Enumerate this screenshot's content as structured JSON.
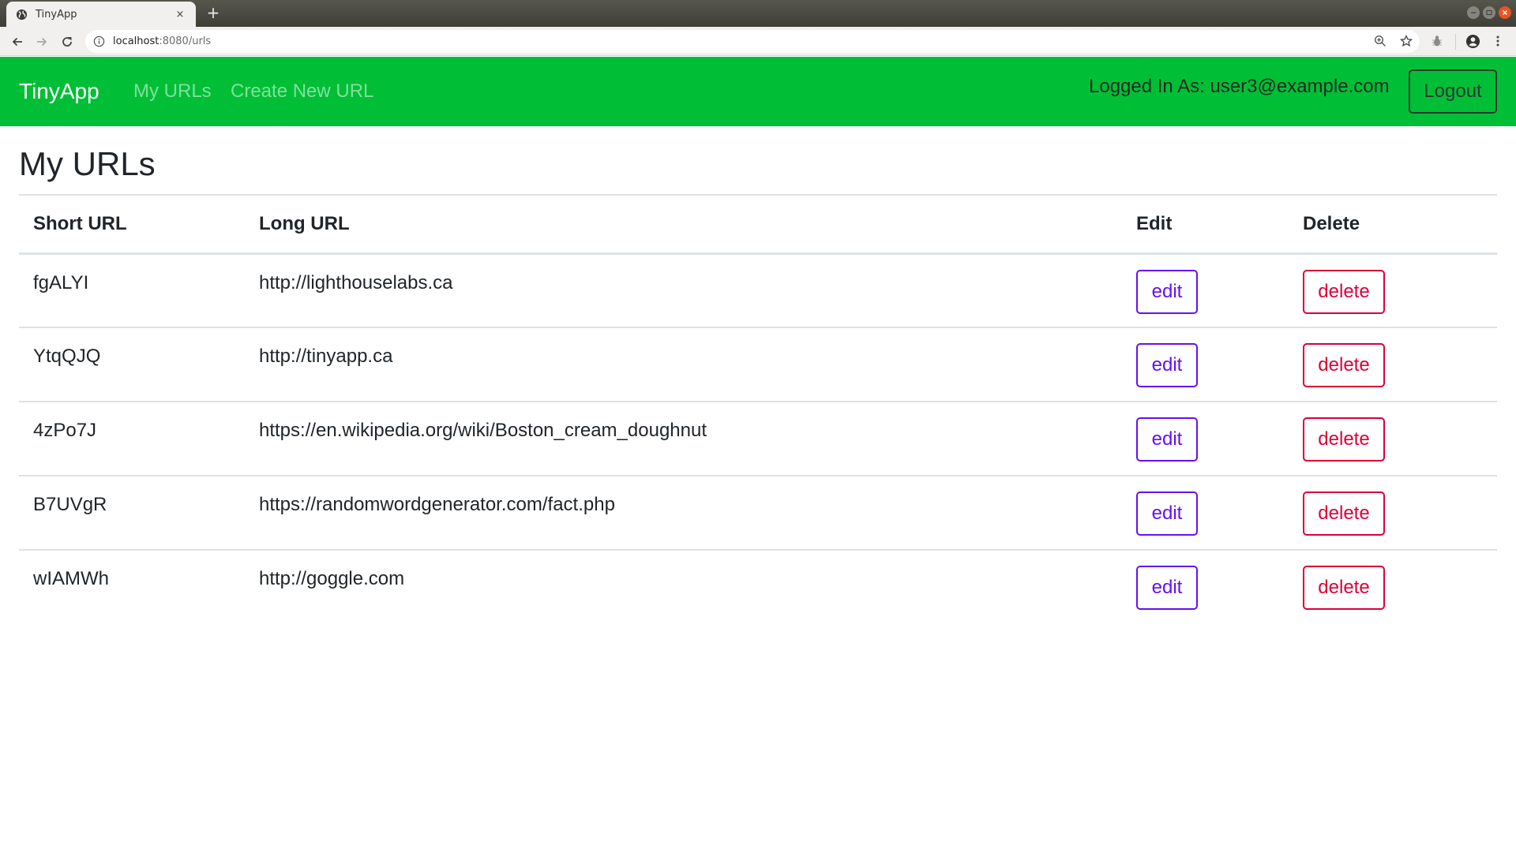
{
  "browser": {
    "tab_title": "TinyApp",
    "tab_close": "×",
    "new_tab": "+",
    "url_host": "localhost",
    "url_path": ":8080/urls"
  },
  "navbar": {
    "brand": "TinyApp",
    "links": [
      {
        "label": "My URLs"
      },
      {
        "label": "Create New URL"
      }
    ],
    "logged_in_text": "Logged In As: user3@example.com",
    "logout_label": "Logout",
    "bg_color": "#00bf36"
  },
  "main": {
    "title": "My URLs",
    "table": {
      "headers": [
        "Short URL",
        "Long URL",
        "Edit",
        "Delete"
      ],
      "rows": [
        {
          "short": "fgALYI",
          "long": "http://lighthouselabs.ca",
          "edit": "edit",
          "delete": "delete"
        },
        {
          "short": "YtqQJQ",
          "long": "http://tinyapp.ca",
          "edit": "edit",
          "delete": "delete"
        },
        {
          "short": "4zPo7J",
          "long": "https://en.wikipedia.org/wiki/Boston_cream_doughnut",
          "edit": "edit",
          "delete": "delete"
        },
        {
          "short": "B7UVgR",
          "long": "https://randomwordgenerator.com/fact.php",
          "edit": "edit",
          "delete": "delete"
        },
        {
          "short": "wIAMWh",
          "long": "http://goggle.com",
          "edit": "edit",
          "delete": "delete"
        }
      ]
    },
    "colors": {
      "edit": "#6610f2",
      "delete": "#dc0039"
    }
  }
}
